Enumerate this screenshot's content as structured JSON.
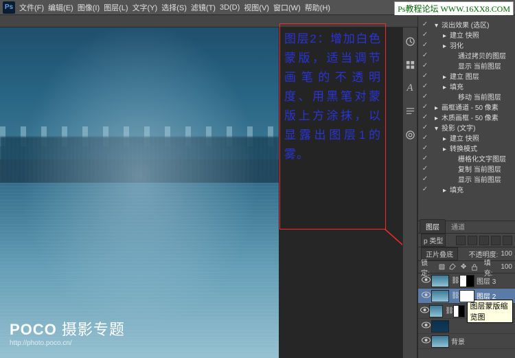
{
  "menu": {
    "items": [
      "文件(F)",
      "编辑(E)",
      "图像(I)",
      "图层(L)",
      "文字(Y)",
      "选择(S)",
      "滤镜(T)",
      "3D(D)",
      "视图(V)",
      "窗口(W)",
      "帮助(H)"
    ]
  },
  "watermark_top": "Ps教程论坛 WWW.16XX8.COM",
  "watermark_bl": {
    "brand": "POCO",
    "title": "摄影专题",
    "url": "http://photo.poco.cn/"
  },
  "annotation": "图层2：增加白色蒙版，适当调节画笔的不透明度、用黑笔对蒙版上方涂抹，以显露出图层1的雾。",
  "toolcol_icons": [
    "history",
    "swatches",
    "text-A",
    "paragraph",
    "cc"
  ],
  "fx_tree": [
    {
      "vis": "✓",
      "indent": 1,
      "tri": "▾",
      "label": "淡出效果 (选区)"
    },
    {
      "vis": "✓",
      "indent": 2,
      "tri": "▸",
      "label": "建立 快照"
    },
    {
      "vis": "✓",
      "indent": 2,
      "tri": "▸",
      "label": "羽化"
    },
    {
      "vis": "✓",
      "indent": 3,
      "tri": "",
      "label": "通过拷贝的图层"
    },
    {
      "vis": "✓",
      "indent": 3,
      "tri": "",
      "label": "显示 当前图层"
    },
    {
      "vis": "✓",
      "indent": 2,
      "tri": "▸",
      "label": "建立 图层"
    },
    {
      "vis": "✓",
      "indent": 2,
      "tri": "▸",
      "label": "填充"
    },
    {
      "vis": "✓",
      "indent": 3,
      "tri": "",
      "label": "移动 当前图层"
    },
    {
      "vis": "✓",
      "indent": 1,
      "tri": "▸",
      "label": "画框通道 - 50 像素"
    },
    {
      "vis": "✓",
      "indent": 1,
      "tri": "▸",
      "label": "木质画框 - 50 像素"
    },
    {
      "vis": "✓",
      "indent": 1,
      "tri": "▾",
      "label": "投影 (文字)"
    },
    {
      "vis": "✓",
      "indent": 2,
      "tri": "▸",
      "label": "建立 快照"
    },
    {
      "vis": "✓",
      "indent": 2,
      "tri": "▸",
      "label": "转换模式"
    },
    {
      "vis": "✓",
      "indent": 3,
      "tri": "",
      "label": "栅格化文字图层"
    },
    {
      "vis": "✓",
      "indent": 3,
      "tri": "",
      "label": "复制 当前图层"
    },
    {
      "vis": "✓",
      "indent": 3,
      "tri": "",
      "label": "显示 当前图层"
    },
    {
      "vis": "✓",
      "indent": 2,
      "tri": "▸",
      "label": "填充"
    }
  ],
  "layers_panel": {
    "tabs": [
      "图层",
      "通道"
    ],
    "active_tab": 0,
    "kind_label": "p 类型",
    "blend_mode": "正片叠底",
    "opacity_label": "不透明度:",
    "opacity_value": "100",
    "lock_label": "锁定:",
    "fill_label": "填充:",
    "fill_value": "100",
    "rows": [
      {
        "eye": "👁",
        "thumb": "img",
        "mask": "bw",
        "name": "图层 3",
        "sel": false
      },
      {
        "eye": "👁",
        "thumb": "img",
        "mask": "wh",
        "name": "图层 2",
        "sel": true
      },
      {
        "eye": "👁",
        "thumb": "img",
        "mask": "bw",
        "name": "",
        "sel": false,
        "tip": "图层蒙版缩览图"
      },
      {
        "eye": "👁",
        "thumb": "imgdark",
        "mask": "",
        "name": "",
        "sel": false
      },
      {
        "eye": "👁",
        "thumb": "img",
        "mask": "",
        "name": "背景",
        "sel": false
      }
    ]
  }
}
